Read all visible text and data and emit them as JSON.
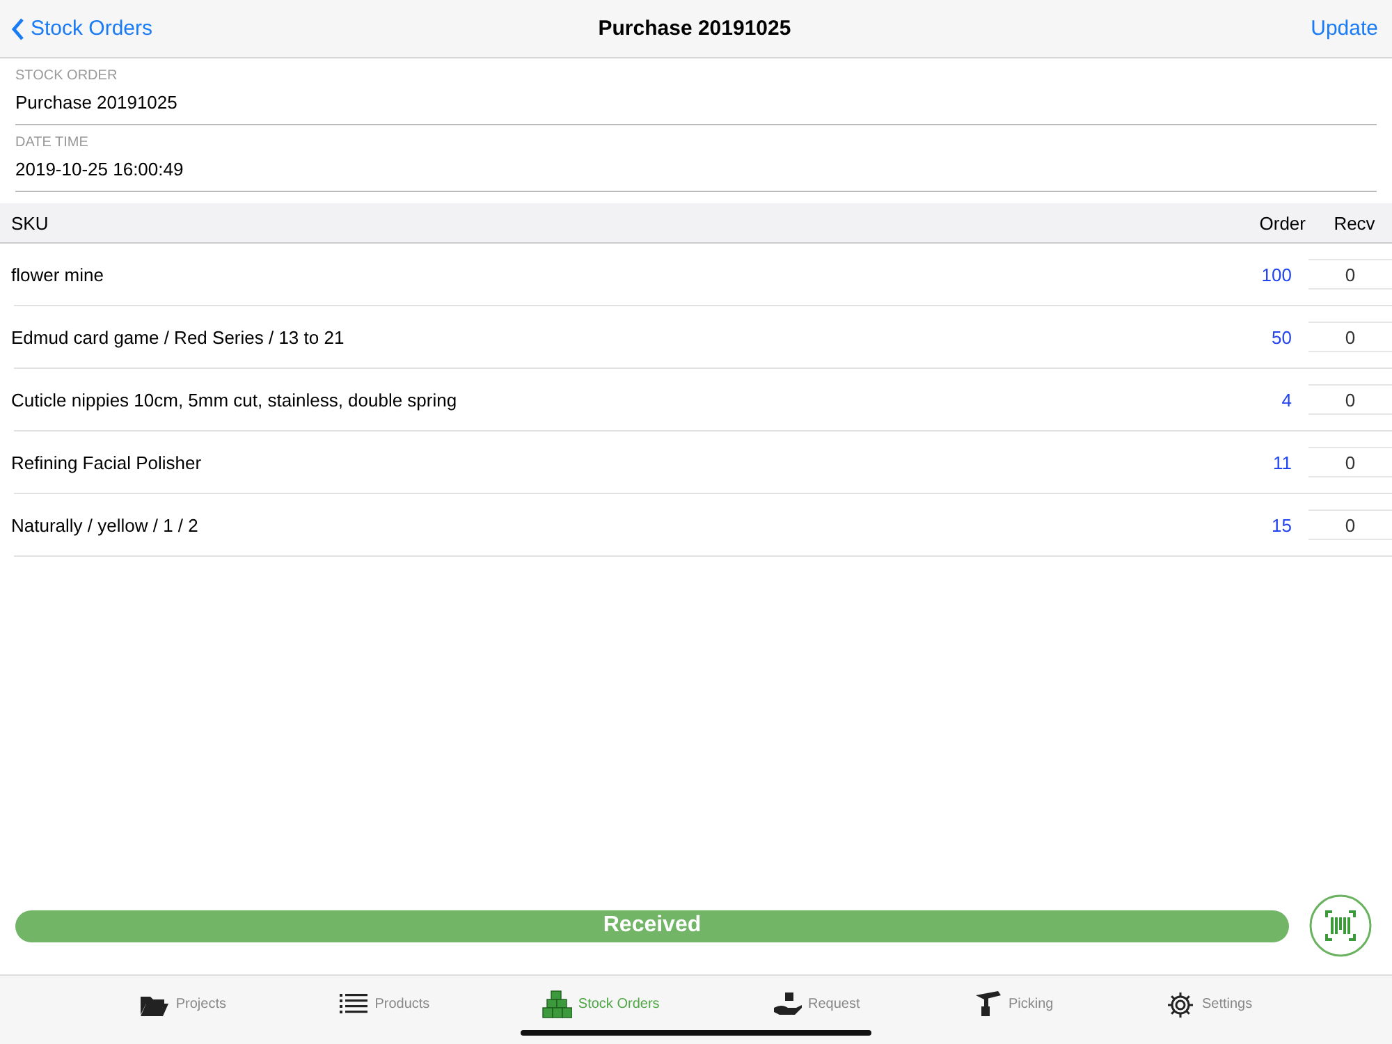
{
  "nav": {
    "back": "Stock Orders",
    "title": "Purchase 20191025",
    "action": "Update"
  },
  "fields": [
    {
      "label": "STOCK ORDER",
      "value": "Purchase 20191025"
    },
    {
      "label": "DATE TIME",
      "value": "2019-10-25 16:00:49"
    }
  ],
  "table": {
    "columns": [
      "SKU",
      "Order",
      "Recv"
    ],
    "rows": [
      {
        "sku": "flower mine",
        "order": "100",
        "recv": "0"
      },
      {
        "sku": "Edmud card game / Red Series / 13 to 21",
        "order": "50",
        "recv": "0"
      },
      {
        "sku": "Cuticle nippies 10cm, 5mm cut, stainless, double spring",
        "order": "4",
        "recv": "0"
      },
      {
        "sku": "Refining Facial Polisher",
        "order": "11",
        "recv": "0"
      },
      {
        "sku": "Naturally / yellow / 1 / 2",
        "order": "15",
        "recv": "0"
      }
    ]
  },
  "received_button": "Received",
  "tabs": [
    {
      "kind": "folder",
      "label": "Projects",
      "selected": false
    },
    {
      "kind": "list",
      "label": "Products",
      "selected": false
    },
    {
      "kind": "boxes",
      "label": "Stock Orders",
      "selected": true
    },
    {
      "kind": "hand",
      "label": "Request",
      "selected": false
    },
    {
      "kind": "picker",
      "label": "Picking",
      "selected": false
    },
    {
      "kind": "gear",
      "label": "Settings",
      "selected": false
    }
  ]
}
